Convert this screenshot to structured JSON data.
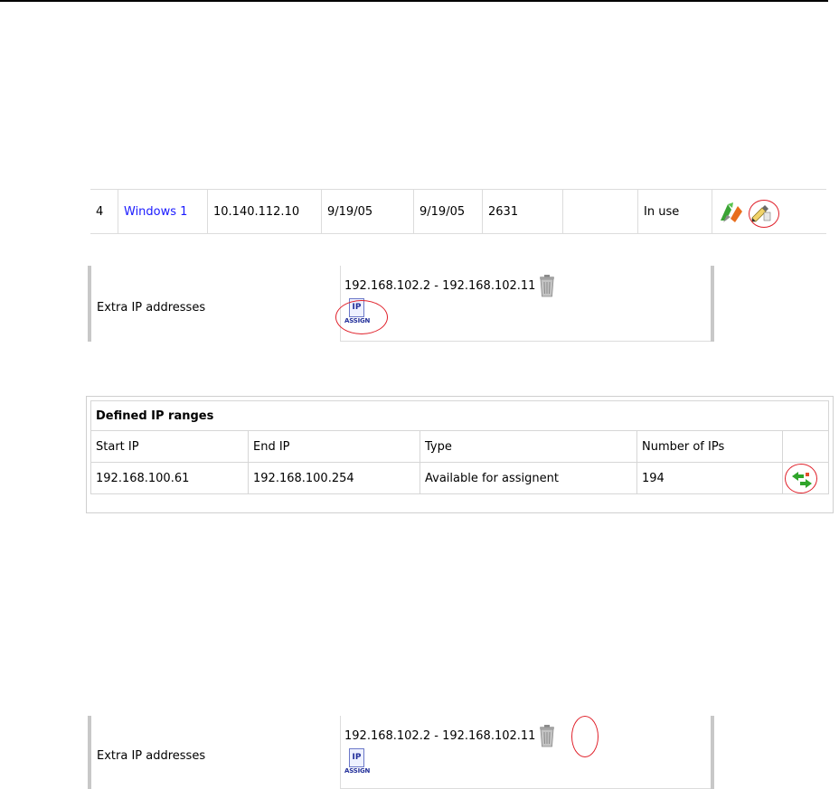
{
  "vm_row": {
    "id": "4",
    "name": "Windows 1",
    "ip": "10.140.112.10",
    "created": "9/19/05",
    "modified": "9/19/05",
    "size": "2631",
    "empty": "",
    "status": "In use",
    "icons": [
      "migrate-icon",
      "edit-icon"
    ]
  },
  "extra_ip_top": {
    "label": "Extra IP addresses",
    "range": "192.168.102.2 - 192.168.102.11",
    "assign_sheet": "IP",
    "assign_word": "ASSIGN"
  },
  "ranges": {
    "title": "Defined IP ranges",
    "headers": [
      "Start IP",
      "End IP",
      "Type",
      "Number of IPs"
    ],
    "row": {
      "start": "192.168.100.61",
      "end": "192.168.100.254",
      "type": "Available for assignent",
      "count": "194"
    },
    "icon": "reassign-icon"
  },
  "extra_ip_bottom": {
    "label": "Extra IP addresses",
    "range": "192.168.102.2 - 192.168.102.11",
    "assign_sheet": "IP",
    "assign_word": "ASSIGN"
  },
  "colors": {
    "link": "#1a1aff",
    "highlight_circle": "#e0202a"
  }
}
